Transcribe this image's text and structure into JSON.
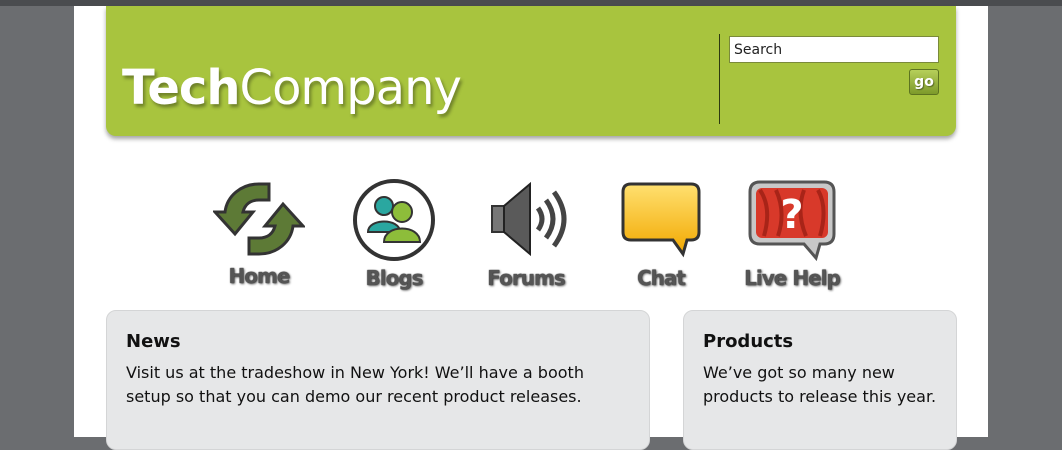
{
  "header": {
    "logo_bold": "Tech",
    "logo_light": "Company",
    "search_value": "Search",
    "go_label": "go",
    "brand_color": "#a8c43e"
  },
  "nav": [
    {
      "label": "Home",
      "icon": "recycle-arrows-icon"
    },
    {
      "label": "Blogs",
      "icon": "people-icon"
    },
    {
      "label": "Forums",
      "icon": "speaker-icon"
    },
    {
      "label": "Chat",
      "icon": "chat-bubble-icon"
    },
    {
      "label": "Live Help",
      "icon": "question-bubble-icon"
    }
  ],
  "news": {
    "title": "News",
    "body_line1": "Visit us at the tradeshow in New York! We’ll have a booth",
    "body_line2": "setup so that you can demo our recent product releases."
  },
  "products": {
    "title": "Products",
    "body_line1": "We’ve got so many new",
    "body_line2": "products to release this year."
  }
}
